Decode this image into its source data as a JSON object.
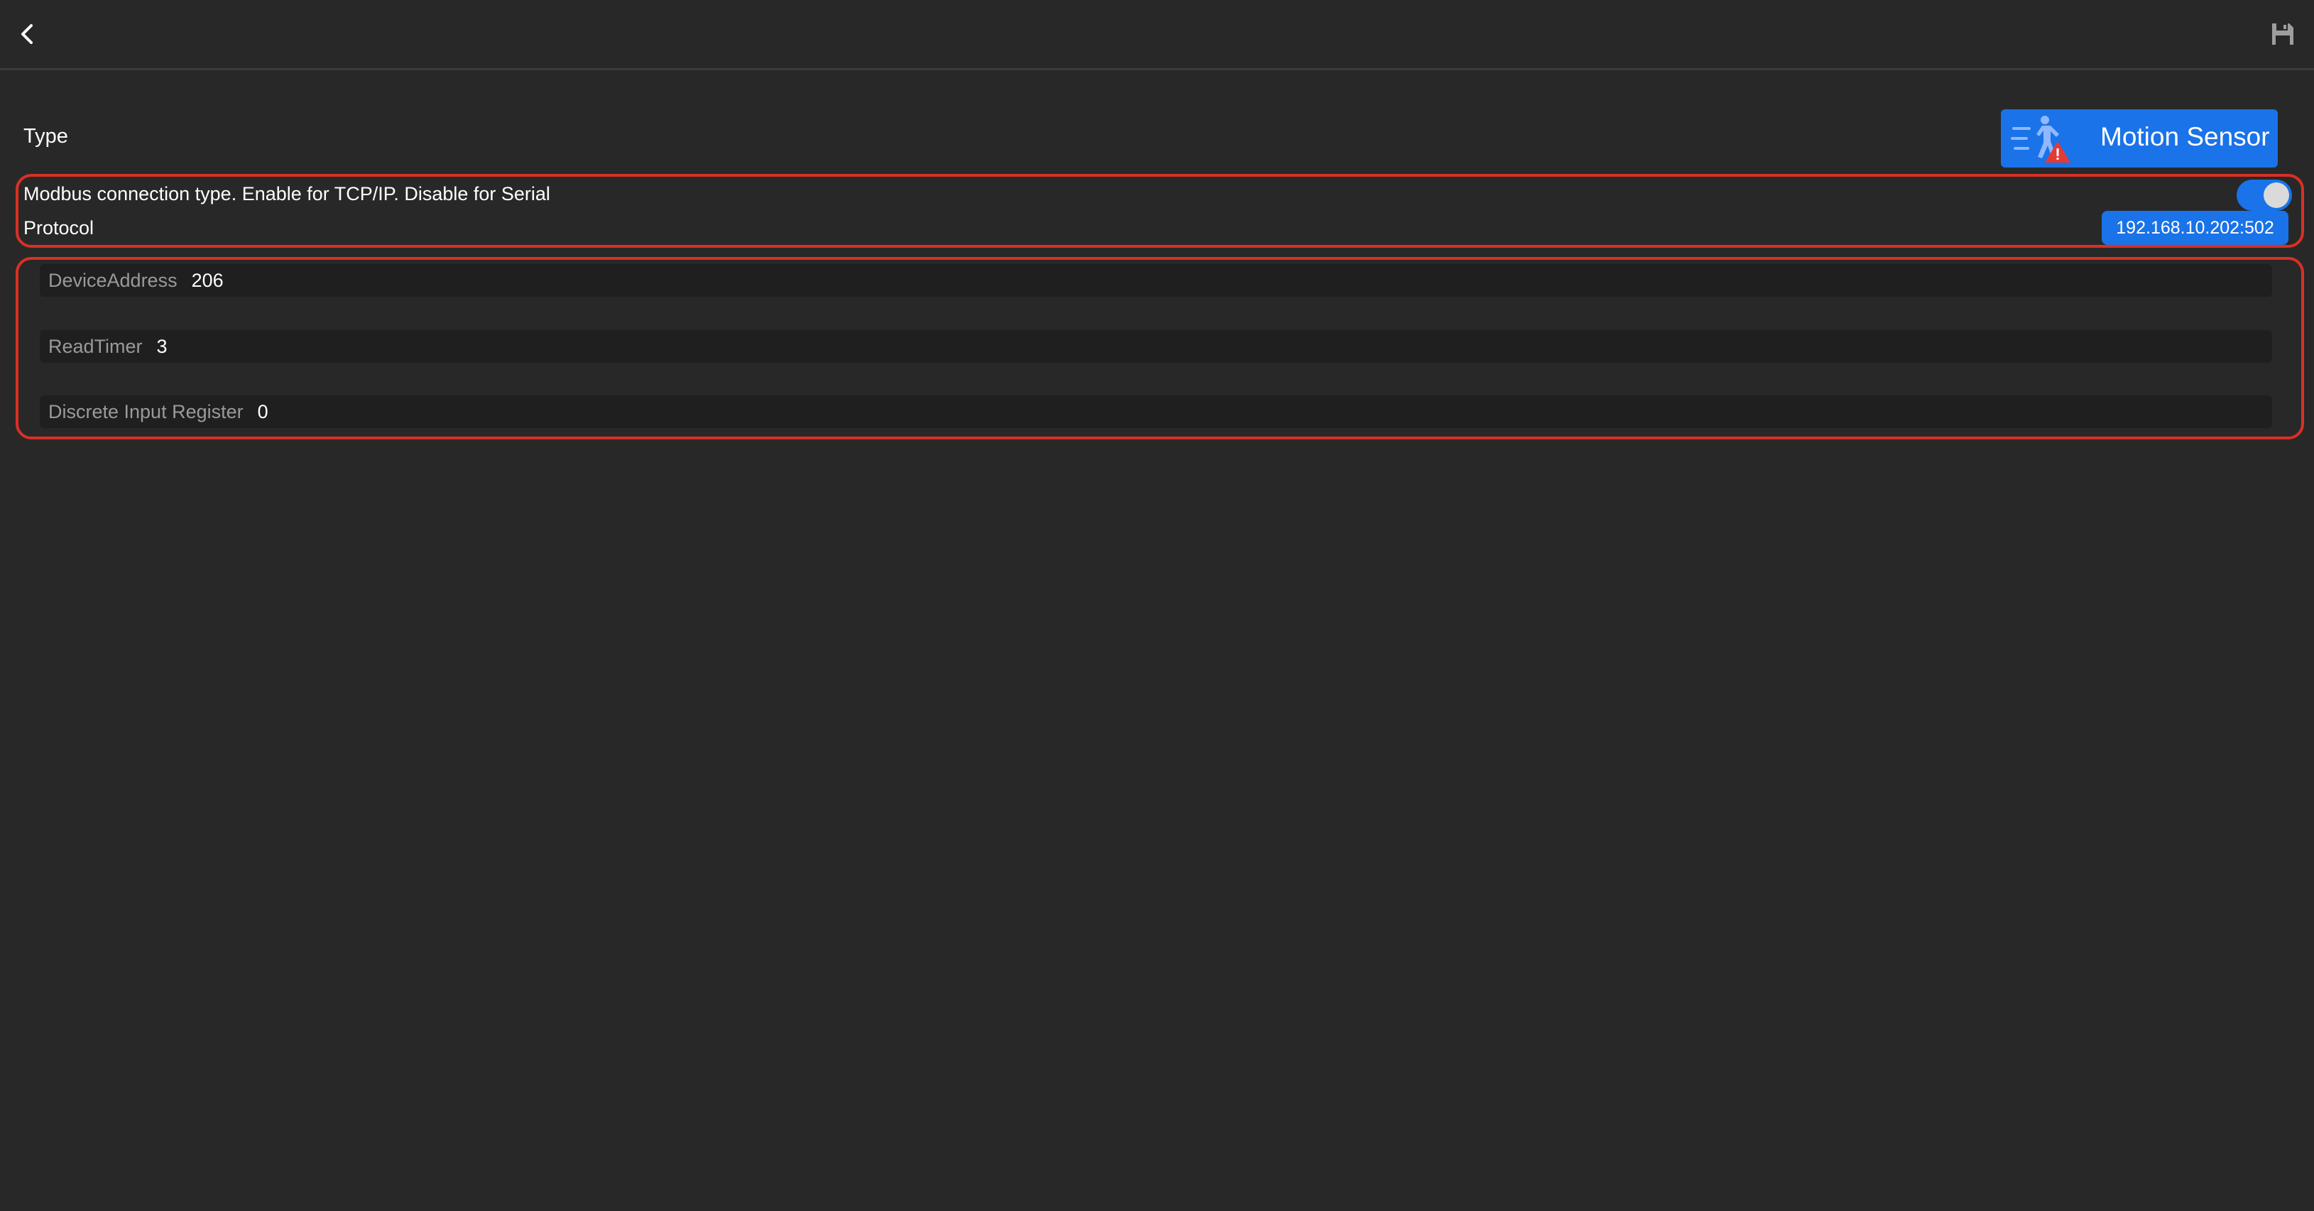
{
  "header": {
    "back_icon": "chevron-left-icon",
    "save_icon": "floppy-disk-icon"
  },
  "type": {
    "label": "Type",
    "selected": "Motion Sensor",
    "icon": "motion-sensor-alert-icon"
  },
  "connection": {
    "toggle_label": "Modbus connection type. Enable for TCP/IP. Disable for Serial",
    "toggle_on": true,
    "protocol_label": "Protocol",
    "protocol_value": "192.168.10.202:502"
  },
  "fields": [
    {
      "label": "DeviceAddress",
      "value": "206"
    },
    {
      "label": "ReadTimer",
      "value": "3"
    },
    {
      "label": "Discrete Input Register",
      "value": "0"
    }
  ],
  "colors": {
    "background": "#282828",
    "accent": "#1a73e8",
    "highlight_border": "#d93025",
    "field_background": "#1f1f1f",
    "warning_red": "#e53935"
  }
}
